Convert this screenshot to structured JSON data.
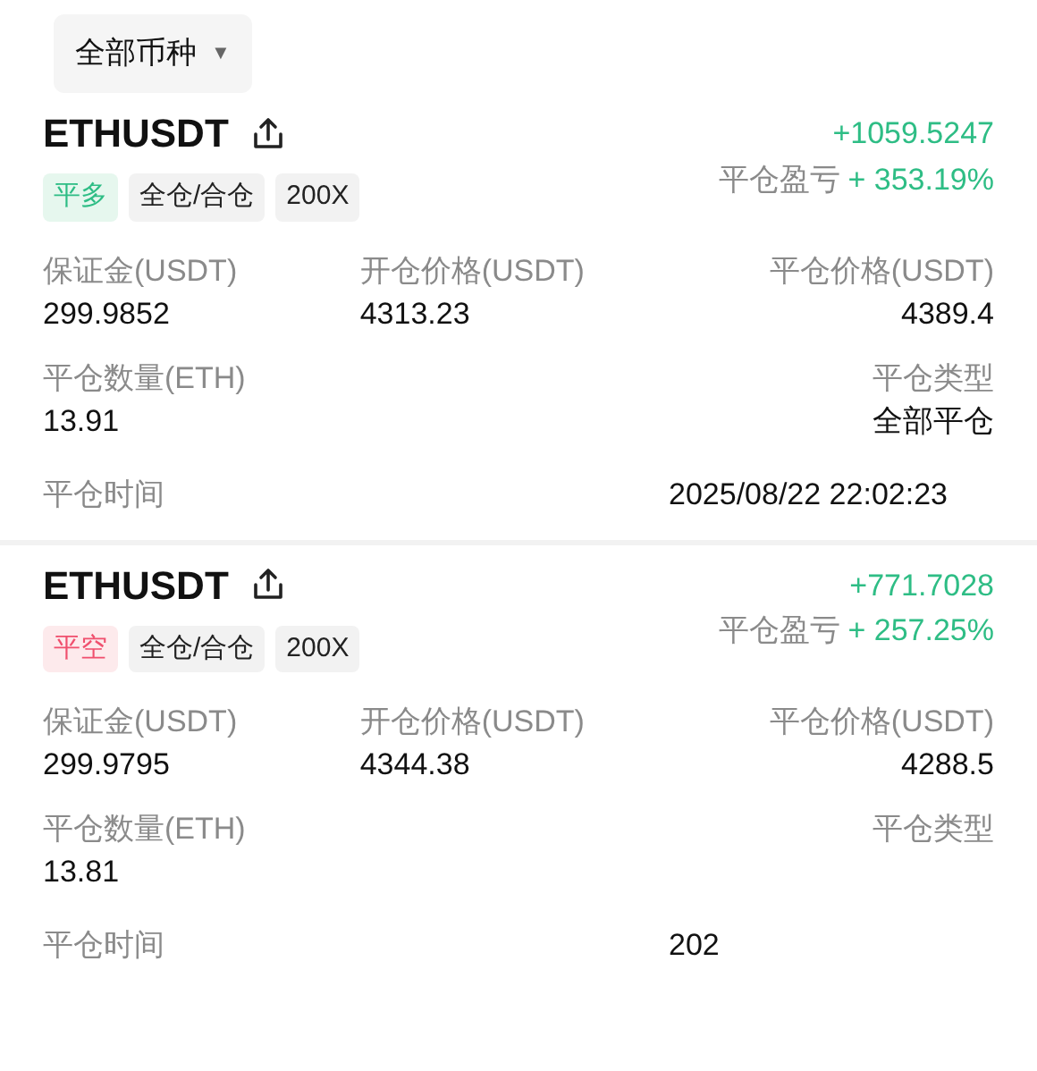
{
  "filter": {
    "label": "全部币种",
    "caret": "▼"
  },
  "positions": [
    {
      "symbol": "ETHUSDT",
      "pnl": "+1059.5247",
      "pnl_label": "平仓盈亏",
      "pnl_percent": "+ 353.19%",
      "tags": [
        {
          "label": "平多",
          "kind": "long"
        },
        {
          "label": "全仓/合仓",
          "kind": "plain"
        },
        {
          "label": "200X",
          "kind": "plain"
        }
      ],
      "margin": {
        "label": "保证金(USDT)",
        "value": "299.9852"
      },
      "open_price": {
        "label": "开仓价格(USDT)",
        "value": "4313.23"
      },
      "close_price": {
        "label": "平仓价格(USDT)",
        "value": "4389.4"
      },
      "close_qty": {
        "label": "平仓数量(ETH)",
        "value": "13.91"
      },
      "close_type": {
        "label": "平仓类型",
        "value": "全部平仓"
      },
      "close_time": {
        "label": "平仓时间",
        "value": "2025/08/22 22:02:23"
      }
    },
    {
      "symbol": "ETHUSDT",
      "pnl": "+771.7028",
      "pnl_label": "平仓盈亏",
      "pnl_percent": "+ 257.25%",
      "tags": [
        {
          "label": "平空",
          "kind": "short"
        },
        {
          "label": "全仓/合仓",
          "kind": "plain"
        },
        {
          "label": "200X",
          "kind": "plain"
        }
      ],
      "margin": {
        "label": "保证金(USDT)",
        "value": "299.9795"
      },
      "open_price": {
        "label": "开仓价格(USDT)",
        "value": "4344.38"
      },
      "close_price": {
        "label": "平仓价格(USDT)",
        "value": "4288.5"
      },
      "close_qty": {
        "label": "平仓数量(ETH)",
        "value": "13.81"
      },
      "close_type": {
        "label": "平仓类型"
      },
      "close_time": {
        "label": "平仓时间",
        "value": "202"
      }
    }
  ]
}
